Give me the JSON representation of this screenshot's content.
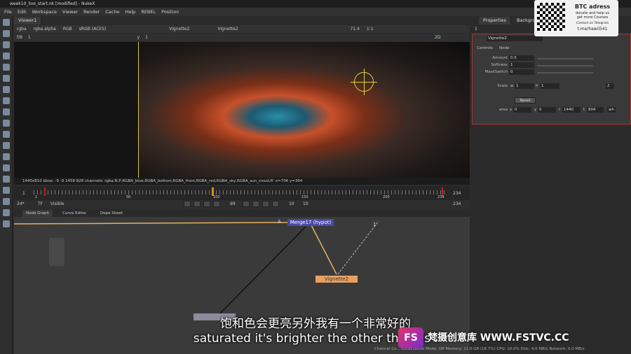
{
  "window": {
    "title": "week10_live_start.nk [modified] - NukeX"
  },
  "menu": [
    "File",
    "Edit",
    "Workspace",
    "Viewer",
    "Render",
    "Cache",
    "Help",
    "REBEL",
    "Position"
  ],
  "viewer": {
    "tab": "Viewer1",
    "channels": "rgba",
    "alpha": "rgba.alpha",
    "display": "RGB",
    "colorspace": "sRGB (ACES)",
    "input_a": "Vignette2",
    "input_b": "Vignette2",
    "zoom": "71.4",
    "ratio": "1:1",
    "mode": "2D",
    "frame_label": "f/8",
    "frame_value": "1",
    "y_label": "y",
    "y_value": "1",
    "info": "1440x810  bbox: -9 -9 1458 828 channels: rgba,N,P,RGBA_blue,RGBA_bottom,RGBA_front,RGBA_red,RGBA_sky,RGBA_sun_cloud,R’  x=706 y=364"
  },
  "timeline": {
    "start": "1",
    "end": "234",
    "end2": "234",
    "ticks": [
      "1",
      "50",
      "100",
      "150",
      "200",
      "234"
    ],
    "current": "99",
    "fps": "24*",
    "tf": "TF",
    "visible": "Visible",
    "step": "10",
    "step2": "10"
  },
  "graph_tabs": [
    "Node Graph",
    "Curve Editor",
    "Dope Sheet"
  ],
  "nodes": {
    "merge": "Merge17 (hypot)",
    "vignette": "Vignette2",
    "input_a": "A",
    "input_1": "1"
  },
  "properties": {
    "tabs": [
      "Properties",
      "Background"
    ],
    "node_name": "Vignette2",
    "sub_tabs": [
      "Controls",
      "Node"
    ],
    "amount_label": "Amount",
    "amount": "0.5",
    "softness_label": "Softness",
    "softness": "1",
    "mask_label": "MaskSwitch",
    "mask": "0",
    "scale_label": "Scale",
    "scale_w_label": "w",
    "scale_w": "1",
    "scale_h_label": "h",
    "scale_h": "1",
    "scale_n": "2",
    "reset": "Reset",
    "area_label": "area",
    "area_x_label": "x",
    "area_x": "0",
    "area_y_label": "y",
    "area_y": "0",
    "area_r_label": "r",
    "area_r": "1440",
    "area_t_label": "t",
    "area_t": "804",
    "area_btn": "wh",
    "panel_count": "1"
  },
  "promo": {
    "line1": "BTC adress",
    "line2": "donate and help us",
    "line3": "get more Courses",
    "line4": "Contact on Telegram",
    "line5": "t.me/hawii541"
  },
  "subtitles": {
    "chinese": "饱和色会更亮另外我有一个非常好的",
    "english": "saturated it's brighter the other thing is i"
  },
  "watermark": {
    "logo": "FS",
    "text": "梵摄创意库 WWW.FSTVC.CC"
  },
  "status_bar": "Channel Co… Localization Mode: Off  Memory: 21.0 GB (18.7%)  CPU: 10.0%  Disk: 4.6 MB/s  Network: 0.0 MB/s"
}
